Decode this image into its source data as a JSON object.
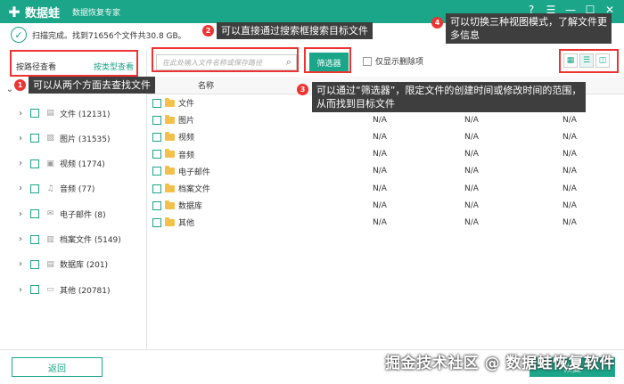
{
  "app": {
    "name": "数据蛙",
    "subtitle": "数据恢复专家",
    "plus_glyph": "✚"
  },
  "window_controls": {
    "help": "?",
    "menu": "☰",
    "minimize": "—",
    "maximize": "☐",
    "close": "✕"
  },
  "scan": {
    "status": "扫描完成。找到71656个文件共30.8 GB。"
  },
  "left_tabs": {
    "by_path": "按路径查看",
    "by_type": "按类型查看"
  },
  "tree": {
    "root_label": "",
    "items": [
      {
        "label": "文件 (12131)",
        "icon": "document-icon"
      },
      {
        "label": "图片 (31535)",
        "icon": "image-icon"
      },
      {
        "label": "视频 (1774)",
        "icon": "video-icon"
      },
      {
        "label": "音频 (77)",
        "icon": "audio-icon"
      },
      {
        "label": "电子邮件 (8)",
        "icon": "email-icon"
      },
      {
        "label": "档案文件 (5149)",
        "icon": "archive-icon"
      },
      {
        "label": "数据库 (201)",
        "icon": "database-icon"
      },
      {
        "label": "其他 (20781)",
        "icon": "folder-icon"
      }
    ]
  },
  "toolbar": {
    "search_placeholder": "在此处输入文件名称或保存路径",
    "filter_label": "筛选器",
    "deleted_only_label": "仅显示删除项"
  },
  "table": {
    "columns": {
      "name": "名称",
      "col_a": "",
      "col_b": "",
      "col_c": ""
    },
    "rows": [
      {
        "name": "文件",
        "a": "",
        "b": "",
        "c": ""
      },
      {
        "name": "图片",
        "a": "N/A",
        "b": "N/A",
        "c": "N/A"
      },
      {
        "name": "视频",
        "a": "N/A",
        "b": "N/A",
        "c": "N/A"
      },
      {
        "name": "音频",
        "a": "N/A",
        "b": "N/A",
        "c": "N/A"
      },
      {
        "name": "电子邮件",
        "a": "N/A",
        "b": "N/A",
        "c": "N/A"
      },
      {
        "name": "档案文件",
        "a": "N/A",
        "b": "N/A",
        "c": "N/A"
      },
      {
        "name": "数据库",
        "a": "N/A",
        "b": "N/A",
        "c": "N/A"
      },
      {
        "name": "其他",
        "a": "N/A",
        "b": "N/A",
        "c": "N/A"
      }
    ]
  },
  "footer": {
    "back_label": "返回",
    "recover_label": "恢复"
  },
  "watermark": "掘金技术社区 @ 数据蛙恢复软件",
  "annotations": {
    "a1": {
      "num": "1",
      "text": "可以从两个方面去查找文件"
    },
    "a2": {
      "num": "2",
      "text": "可以直接通过搜索框搜索目标文件"
    },
    "a3": {
      "num": "3",
      "text": "可以通过“筛选器”，限定文件的创建时间或修改时间的范围，\n从而找到目标文件"
    },
    "a4": {
      "num": "4",
      "text": "可以切换三种视图模式，了解文件更\n多信息"
    }
  },
  "colors": {
    "brand": "#1ba589",
    "annotation_red": "#e33333",
    "callout_bg": "#3e3e3e",
    "folder": "#f3c14b"
  }
}
